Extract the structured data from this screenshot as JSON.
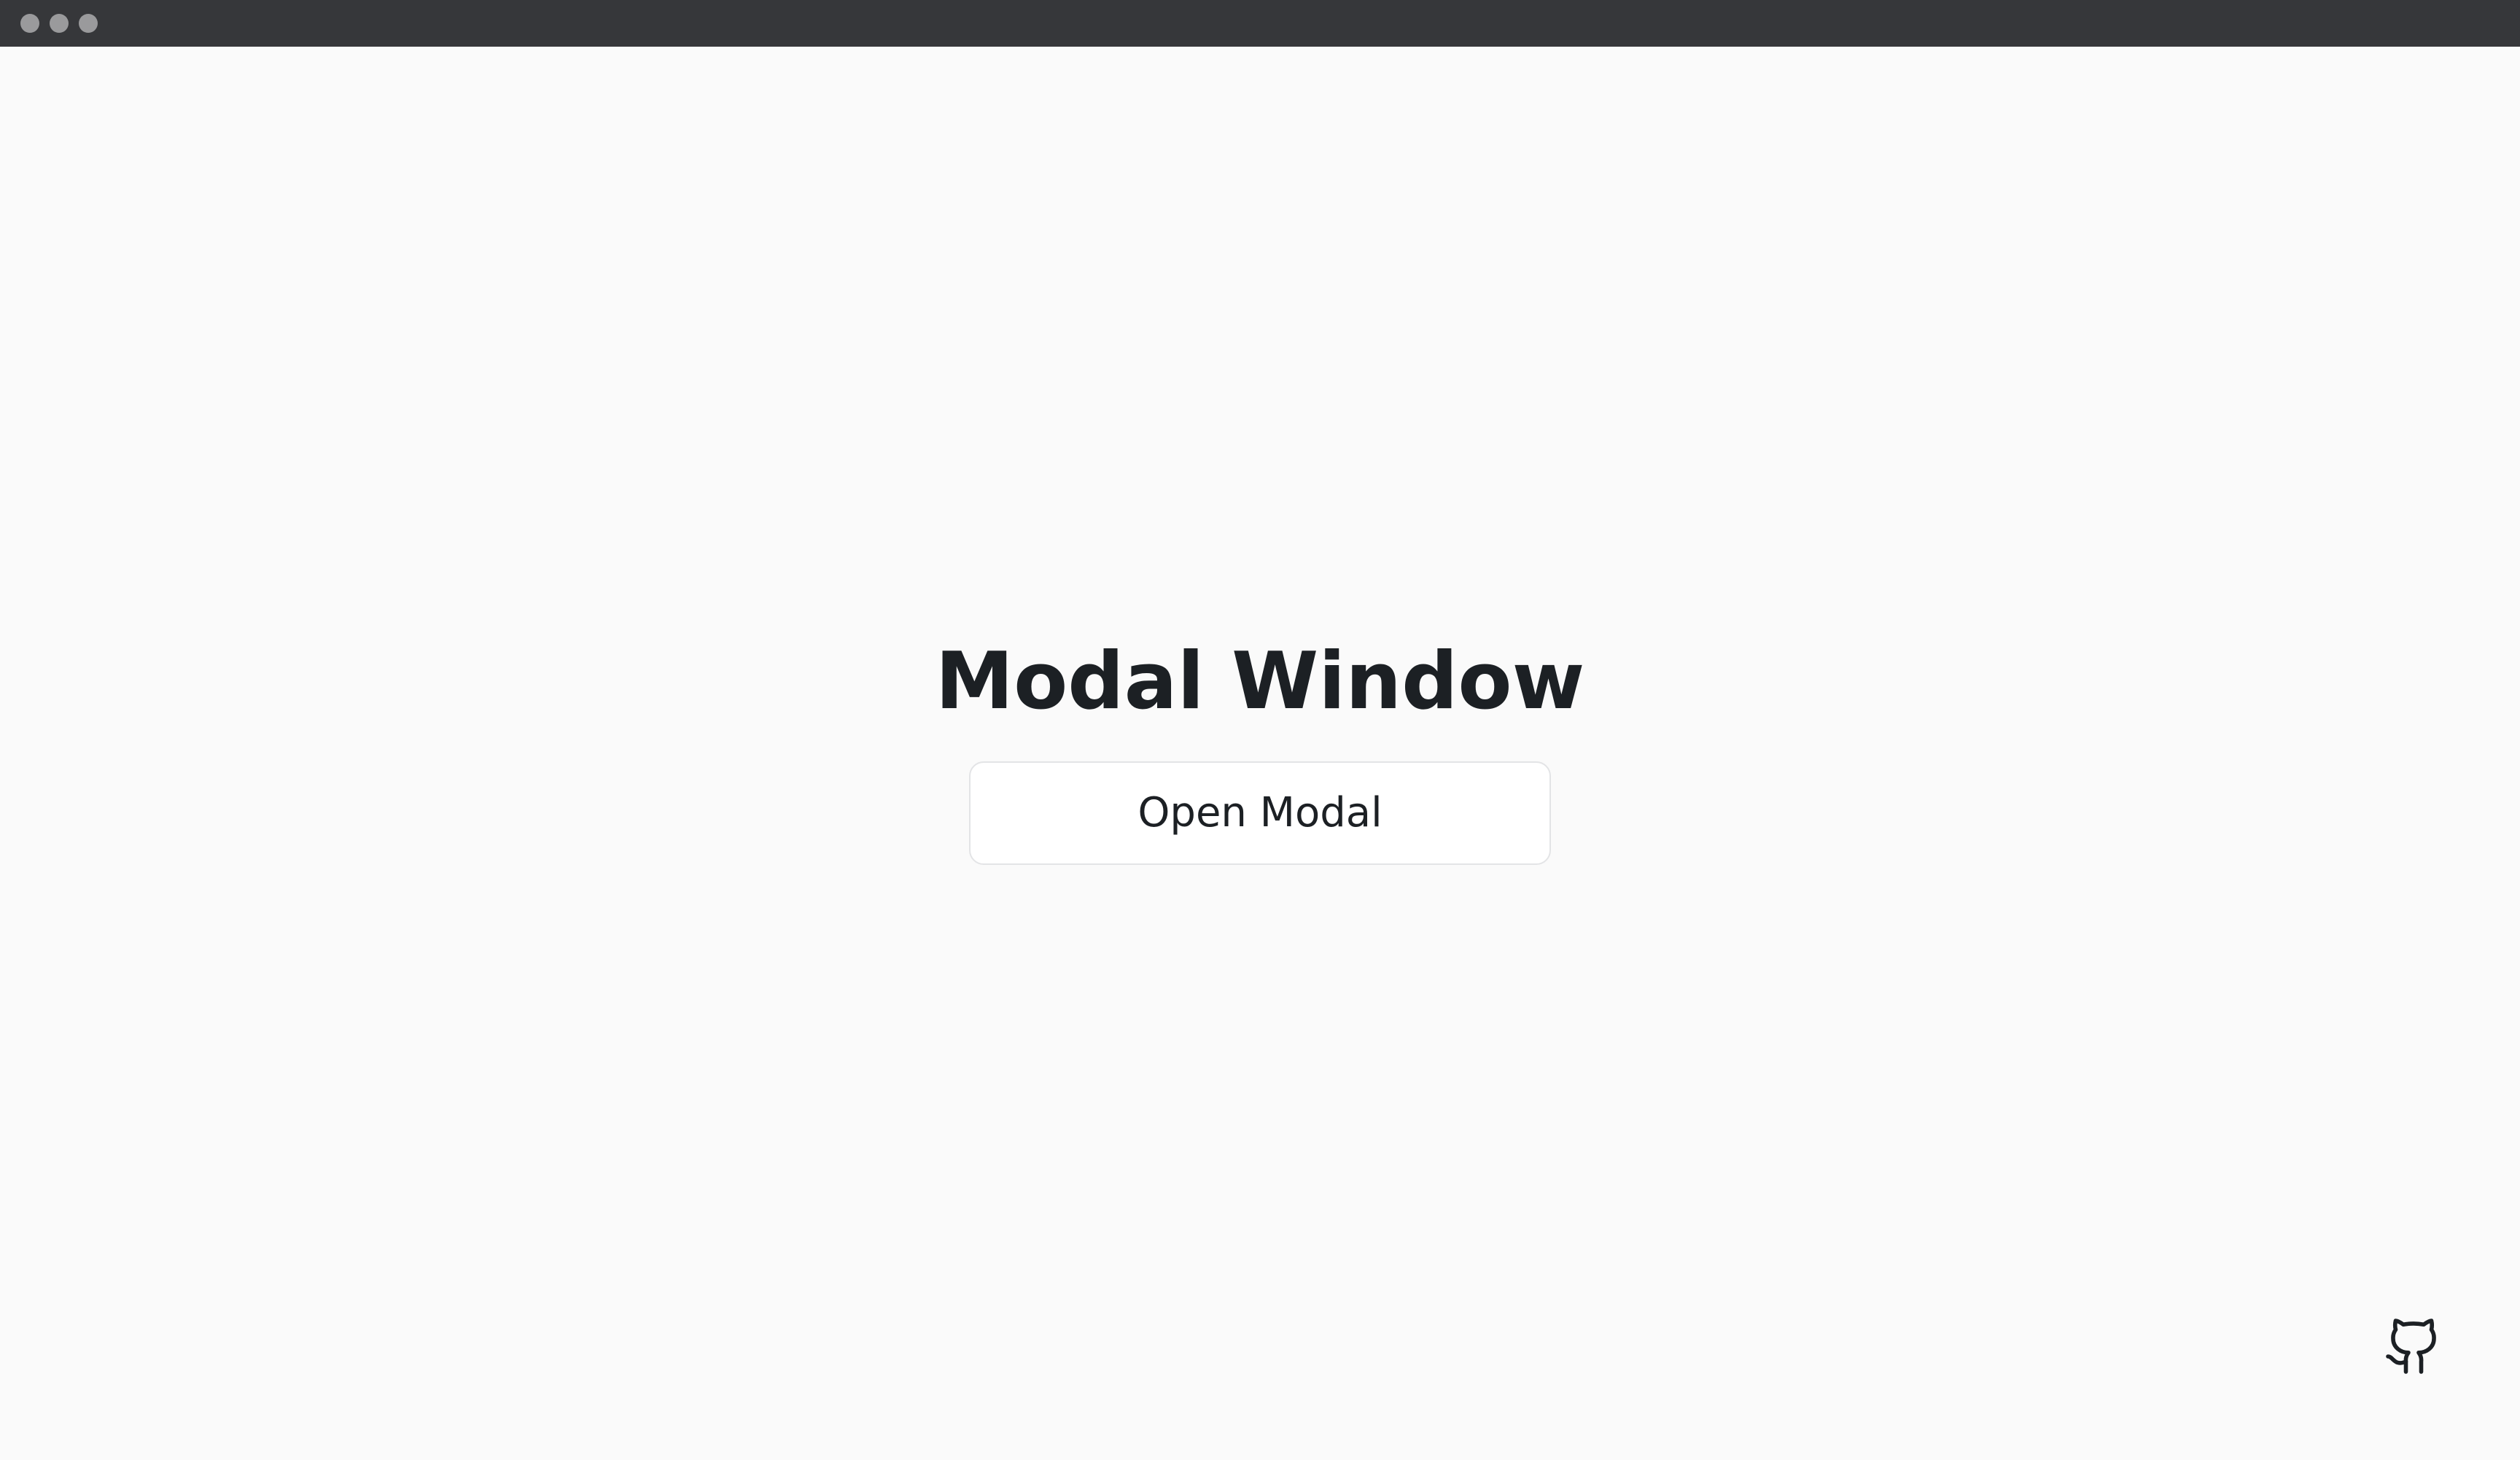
{
  "window": {
    "controls": [
      "close-dot",
      "minimize-dot",
      "maximize-dot"
    ]
  },
  "main": {
    "title": "Modal Window",
    "open_button_label": "Open Modal"
  },
  "footer": {
    "github_icon": "github-icon"
  },
  "colors": {
    "background": "#fafafa",
    "titlebar": "#36373a",
    "text": "#1c2024",
    "button_bg": "#ffffff",
    "button_border": "#e3e4e6"
  }
}
